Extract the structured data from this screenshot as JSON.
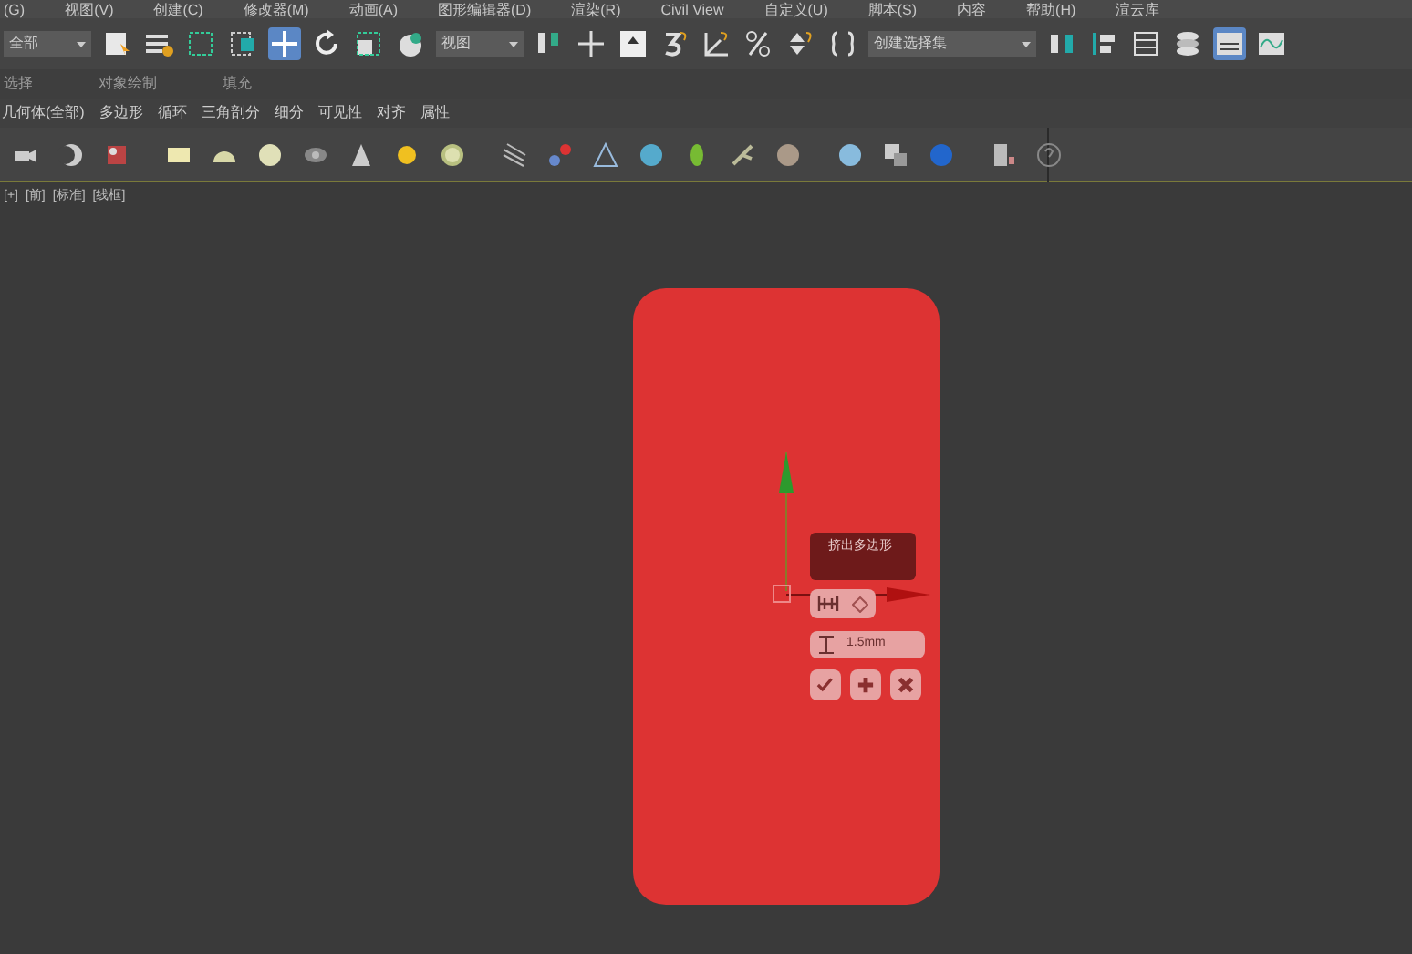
{
  "menu_bar": [
    "(G)",
    "视图(V)",
    "创建(C)",
    "修改器(M)",
    "动画(A)",
    "图形编辑器(D)",
    "渲染(R)",
    "Civil View",
    "自定义(U)",
    "脚本(S)",
    "内容",
    "帮助(H)",
    "渲云库"
  ],
  "main_toolbar": {
    "selection_filter": "全部",
    "reference_coordinate": "视图",
    "named_selection_set": "创建选择集"
  },
  "ribbon_panels": [
    "选择",
    "对象绘制",
    "填充"
  ],
  "ribbon_tabs": [
    "几何体(全部)",
    "多边形",
    "循环",
    "三角剖分",
    "细分",
    "可见性",
    "对齐",
    "属性"
  ],
  "viewport": {
    "labels": [
      "[+]",
      "[前]",
      "[标准]",
      "[线框]"
    ],
    "caddy": {
      "title": "挤出多边形",
      "value": "1.5mm"
    }
  }
}
